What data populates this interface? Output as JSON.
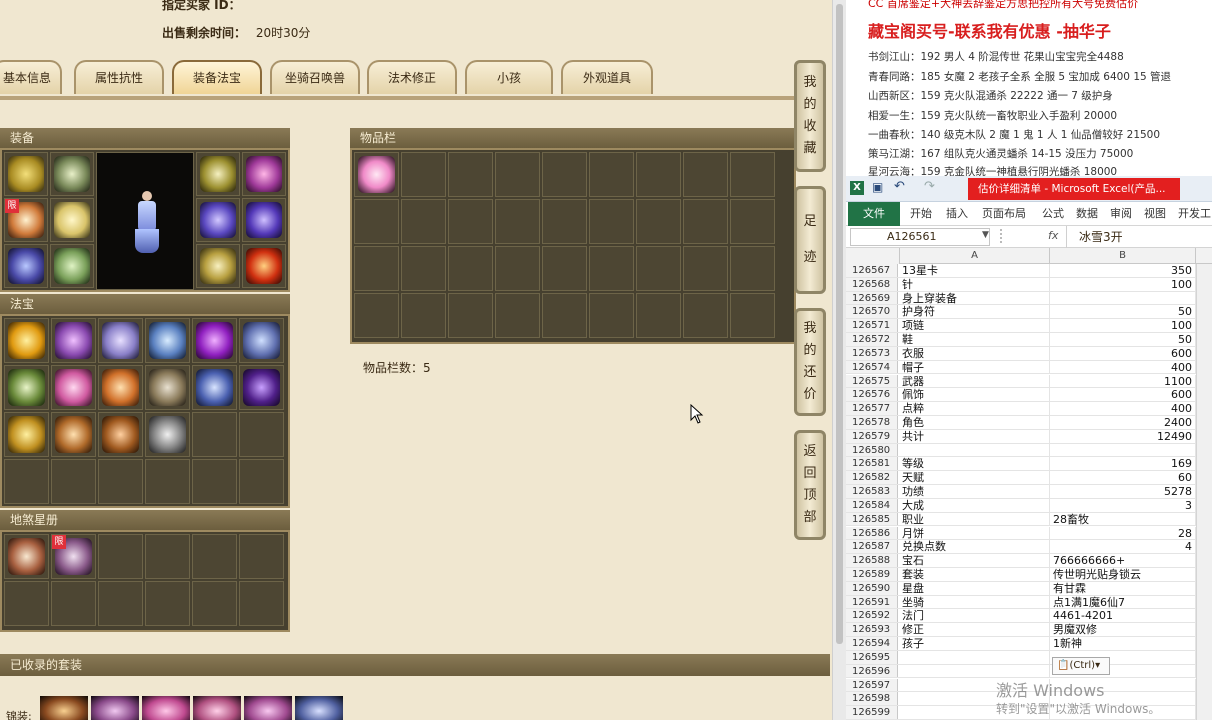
{
  "game": {
    "seller_label": "指定买家 ID：",
    "time_label": "出售剩余时间：",
    "time_value": "20时30分",
    "tabs": [
      "基本信息",
      "属性抗性",
      "装备法宝",
      "坐骑召唤兽",
      "法术修正",
      "小孩",
      "外观道具"
    ],
    "active_tab": "装备法宝",
    "equip_title": "装备",
    "fabao_title": "法宝",
    "xingce_title": "地煞星册",
    "inventory_title": "物品栏",
    "inventory_count_label": "物品栏数：5",
    "collected_title": "已收录的套装",
    "bottom_label": "锦装:",
    "limited_badge": "限",
    "side_buttons": [
      {
        "chars": [
          "我",
          "的",
          "收",
          "藏"
        ]
      },
      {
        "chars": [
          "足",
          "迹"
        ]
      },
      {
        "chars": [
          "我",
          "的",
          "还",
          "价"
        ]
      },
      {
        "chars": [
          "返",
          "回",
          "顶",
          "部"
        ]
      }
    ]
  },
  "ad": {
    "top_text": "CC 首席鉴定+大神丢辞鉴定方思把控所有大号免费估价",
    "headline": "藏宝阁买号-联系我有优惠 -抽华子",
    "lines": [
      "书剑江山：192 男人 4 阶混传世 花果山宝宝完全4488",
      "青春同路：185 女魔 2 老孩子全系 全服 5 宝加成 6400 15 管退",
      "山西新区：159 克火队混通杀 22222 通一 7 级护身",
      "相爱一生：159 克火队统一畜牧职业入手盈利 20000",
      "一曲春秋：140 级克木队 2 魔 1 鬼 1 人 1 仙品僧较好 21500",
      "策马江湖：167 组队克火通灵蟠杀 14-15 没压力 75000",
      "星河云海：159 克金队统一神植悬行阴光蟠杀 18000"
    ]
  },
  "excel": {
    "window_title": "估价详细清单 - Microsoft Excel(产品...",
    "ribbon_file": "文件",
    "ribbon_tabs": [
      "开始",
      "插入",
      "页面布局",
      "公式",
      "数据",
      "审阅",
      "视图",
      "开发工"
    ],
    "name_box": "A126561",
    "fx": "fx",
    "formula": "冰雪3开",
    "col_a": "A",
    "col_b": "B",
    "rows": [
      {
        "n": "126567",
        "a": "13星卡",
        "b": "350"
      },
      {
        "n": "126568",
        "a": "针",
        "b": "100"
      },
      {
        "n": "126569",
        "a": "身上穿装备",
        "b": ""
      },
      {
        "n": "126570",
        "a": "护身符",
        "b": "50"
      },
      {
        "n": "126571",
        "a": "项链",
        "b": "100"
      },
      {
        "n": "126572",
        "a": "鞋",
        "b": "50"
      },
      {
        "n": "126573",
        "a": "衣服",
        "b": "600"
      },
      {
        "n": "126574",
        "a": "帽子",
        "b": "400"
      },
      {
        "n": "126575",
        "a": "武器",
        "b": "1100"
      },
      {
        "n": "126576",
        "a": "佩饰",
        "b": "600"
      },
      {
        "n": "126577",
        "a": "点粹",
        "b": "400"
      },
      {
        "n": "126578",
        "a": "角色",
        "b": "2400"
      },
      {
        "n": "126579",
        "a": "共计",
        "b": "12490"
      },
      {
        "n": "126580",
        "a": "",
        "b": ""
      },
      {
        "n": "126581",
        "a": "等级",
        "b": "169"
      },
      {
        "n": "126582",
        "a": "天赋",
        "b": "60"
      },
      {
        "n": "126583",
        "a": "功绩",
        "b": "5278"
      },
      {
        "n": "126584",
        "a": "大成",
        "b": "3"
      },
      {
        "n": "126585",
        "a": "职业",
        "b": "28畜牧",
        "left": true
      },
      {
        "n": "126586",
        "a": "月饼",
        "b": "28"
      },
      {
        "n": "126587",
        "a": "兑换点数",
        "b": "4"
      },
      {
        "n": "126588",
        "a": "宝石",
        "b": "766666666+",
        "left": true
      },
      {
        "n": "126589",
        "a": "套装",
        "b": "传世明光贴身锁云",
        "left": true
      },
      {
        "n": "126590",
        "a": "星盘",
        "b": "有甘霖",
        "left": true
      },
      {
        "n": "126591",
        "a": "坐骑",
        "b": "点1满1魔6仙7",
        "left": true
      },
      {
        "n": "126592",
        "a": "法门",
        "b": "4461-4201",
        "left": true
      },
      {
        "n": "126593",
        "a": "修正",
        "b": "男魔双修",
        "left": true
      },
      {
        "n": "126594",
        "a": "孩子",
        "b": "1新神",
        "left": true
      },
      {
        "n": "126595",
        "a": "",
        "b": ""
      },
      {
        "n": "126596",
        "a": "",
        "b": ""
      },
      {
        "n": "126597",
        "a": "",
        "b": ""
      },
      {
        "n": "126598",
        "a": "",
        "b": ""
      },
      {
        "n": "126599",
        "a": "",
        "b": ""
      }
    ],
    "paste_tag": "(Ctrl)",
    "watermark_1": "激活 Windows",
    "watermark_2": "转到\"设置\"以激活 Windows。"
  },
  "colors": {
    "tab_active": "#f0d596",
    "panel_bg": "#46402f",
    "ad_red": "#d81e1e",
    "excel_green": "#217346"
  }
}
